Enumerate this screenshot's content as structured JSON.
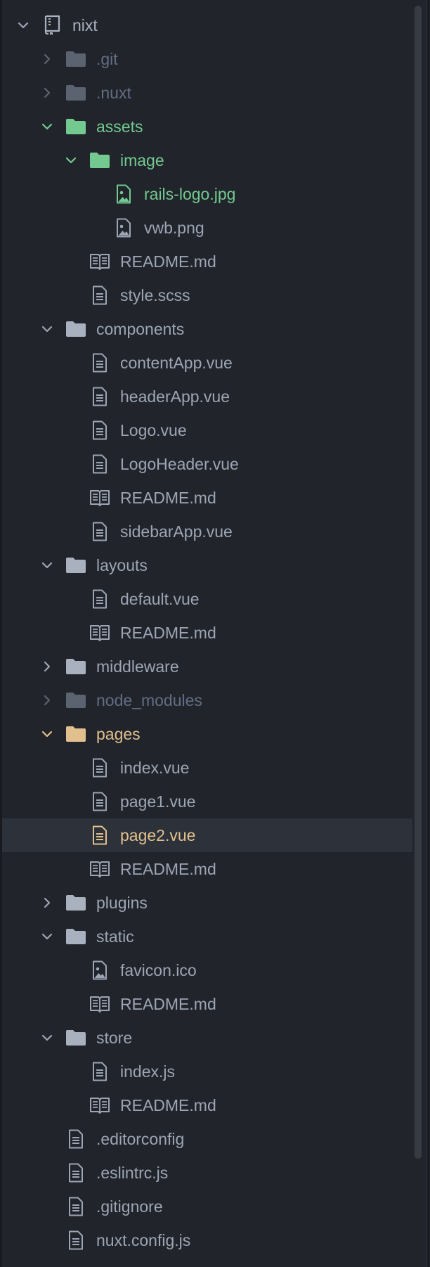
{
  "tree": [
    {
      "id": "nixt",
      "label": "nixt",
      "kind": "repo",
      "depth": 0,
      "expanded": true,
      "status": "root"
    },
    {
      "id": "git",
      "label": ".git",
      "kind": "folder",
      "depth": 1,
      "expanded": false,
      "status": "ignored"
    },
    {
      "id": "nuxt",
      "label": ".nuxt",
      "kind": "folder",
      "depth": 1,
      "expanded": false,
      "status": "ignored"
    },
    {
      "id": "assets",
      "label": "assets",
      "kind": "folder",
      "depth": 1,
      "expanded": true,
      "status": "added"
    },
    {
      "id": "assets-image",
      "label": "image",
      "kind": "folder",
      "depth": 2,
      "expanded": true,
      "status": "added"
    },
    {
      "id": "rails-logo",
      "label": "rails-logo.jpg",
      "kind": "image",
      "depth": 3,
      "status": "added"
    },
    {
      "id": "vwb",
      "label": "vwb.png",
      "kind": "image",
      "depth": 3,
      "status": "default"
    },
    {
      "id": "assets-readme",
      "label": "README.md",
      "kind": "book",
      "depth": 2,
      "status": "default"
    },
    {
      "id": "style-scss",
      "label": "style.scss",
      "kind": "file",
      "depth": 2,
      "status": "default"
    },
    {
      "id": "components",
      "label": "components",
      "kind": "folder",
      "depth": 1,
      "expanded": true,
      "status": "default"
    },
    {
      "id": "content-app",
      "label": "contentApp.vue",
      "kind": "file",
      "depth": 2,
      "status": "default"
    },
    {
      "id": "header-app",
      "label": "headerApp.vue",
      "kind": "file",
      "depth": 2,
      "status": "default"
    },
    {
      "id": "logo-vue",
      "label": "Logo.vue",
      "kind": "file",
      "depth": 2,
      "status": "default"
    },
    {
      "id": "logo-header",
      "label": "LogoHeader.vue",
      "kind": "file",
      "depth": 2,
      "status": "default"
    },
    {
      "id": "components-readme",
      "label": "README.md",
      "kind": "book",
      "depth": 2,
      "status": "default"
    },
    {
      "id": "sidebar-app",
      "label": "sidebarApp.vue",
      "kind": "file",
      "depth": 2,
      "status": "default"
    },
    {
      "id": "layouts",
      "label": "layouts",
      "kind": "folder",
      "depth": 1,
      "expanded": true,
      "status": "default"
    },
    {
      "id": "default-vue",
      "label": "default.vue",
      "kind": "file",
      "depth": 2,
      "status": "default"
    },
    {
      "id": "layouts-readme",
      "label": "README.md",
      "kind": "book",
      "depth": 2,
      "status": "default"
    },
    {
      "id": "middleware",
      "label": "middleware",
      "kind": "folder",
      "depth": 1,
      "expanded": false,
      "status": "default"
    },
    {
      "id": "node-modules",
      "label": "node_modules",
      "kind": "folder",
      "depth": 1,
      "expanded": false,
      "status": "ignored"
    },
    {
      "id": "pages",
      "label": "pages",
      "kind": "folder",
      "depth": 1,
      "expanded": true,
      "status": "modified"
    },
    {
      "id": "index-vue",
      "label": "index.vue",
      "kind": "file",
      "depth": 2,
      "status": "default"
    },
    {
      "id": "page1-vue",
      "label": "page1.vue",
      "kind": "file",
      "depth": 2,
      "status": "default"
    },
    {
      "id": "page2-vue",
      "label": "page2.vue",
      "kind": "file",
      "depth": 2,
      "status": "modified",
      "selected": true
    },
    {
      "id": "pages-readme",
      "label": "README.md",
      "kind": "book",
      "depth": 2,
      "status": "default"
    },
    {
      "id": "plugins",
      "label": "plugins",
      "kind": "folder",
      "depth": 1,
      "expanded": false,
      "status": "default"
    },
    {
      "id": "static",
      "label": "static",
      "kind": "folder",
      "depth": 1,
      "expanded": true,
      "status": "default"
    },
    {
      "id": "favicon",
      "label": "favicon.ico",
      "kind": "image",
      "depth": 2,
      "status": "default"
    },
    {
      "id": "static-readme",
      "label": "README.md",
      "kind": "book",
      "depth": 2,
      "status": "default"
    },
    {
      "id": "store",
      "label": "store",
      "kind": "folder",
      "depth": 1,
      "expanded": true,
      "status": "default"
    },
    {
      "id": "index-js",
      "label": "index.js",
      "kind": "file",
      "depth": 2,
      "status": "default"
    },
    {
      "id": "store-readme",
      "label": "README.md",
      "kind": "book",
      "depth": 2,
      "status": "default"
    },
    {
      "id": "editorconfig",
      "label": ".editorconfig",
      "kind": "file",
      "depth": 1,
      "status": "default"
    },
    {
      "id": "eslintrc",
      "label": ".eslintrc.js",
      "kind": "file",
      "depth": 1,
      "status": "default"
    },
    {
      "id": "gitignore",
      "label": ".gitignore",
      "kind": "file",
      "depth": 1,
      "status": "default"
    },
    {
      "id": "nuxt-config",
      "label": "nuxt.config.js",
      "kind": "file",
      "depth": 1,
      "status": "default"
    }
  ],
  "colors": {
    "background": "#21252b",
    "selection": "#2c313a",
    "text_default": "#9da5b4",
    "text_ignored": "#636d83",
    "text_added": "#73c990",
    "text_modified": "#e2c08d"
  },
  "icons": {
    "repo": "repo-icon",
    "folder": "folder-icon",
    "file": "file-icon",
    "book": "book-icon",
    "image": "image-icon",
    "chevron_open": "chevron-down-icon",
    "chevron_closed": "chevron-right-icon"
  }
}
